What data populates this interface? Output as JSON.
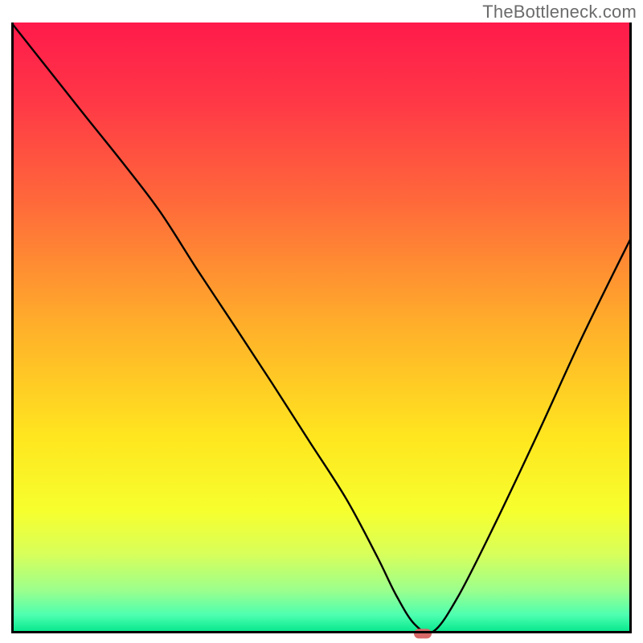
{
  "watermark": "TheBottleneck.com",
  "chart_data": {
    "type": "line",
    "title": "",
    "xlabel": "",
    "ylabel": "",
    "xlim": [
      0,
      100
    ],
    "ylim": [
      0,
      100
    ],
    "grid": false,
    "series": [
      {
        "name": "bottleneck-curve",
        "x": [
          0,
          6,
          12,
          18,
          24,
          30,
          36,
          42,
          48,
          54,
          59,
          62,
          65,
          68,
          72,
          78,
          85,
          92,
          100
        ],
        "y": [
          100,
          92.3,
          84.6,
          77,
          69,
          59.5,
          50.3,
          41,
          31.5,
          22,
          12.5,
          6.3,
          1.5,
          0.3,
          6,
          18,
          33,
          48.5,
          65
        ]
      }
    ],
    "marker_at": {
      "x": 66.3,
      "y": 0.3
    },
    "background_gradient": {
      "stops": [
        {
          "offset": 0,
          "color": "#ff1a4b"
        },
        {
          "offset": 0.12,
          "color": "#ff3547"
        },
        {
          "offset": 0.3,
          "color": "#ff6b3a"
        },
        {
          "offset": 0.5,
          "color": "#ffb02a"
        },
        {
          "offset": 0.68,
          "color": "#ffe61f"
        },
        {
          "offset": 0.8,
          "color": "#f6ff2e"
        },
        {
          "offset": 0.87,
          "color": "#d8ff5a"
        },
        {
          "offset": 0.93,
          "color": "#9bff8d"
        },
        {
          "offset": 0.97,
          "color": "#4dffb0"
        },
        {
          "offset": 1.0,
          "color": "#00e58a"
        }
      ]
    }
  }
}
